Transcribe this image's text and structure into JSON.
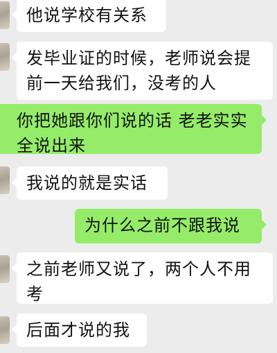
{
  "colors": {
    "background": "#ececec",
    "incoming_bubble": "#ffffff",
    "outgoing_bubble": "#95ec69",
    "text": "#111111"
  },
  "messages": [
    {
      "side": "received",
      "text": "他说学校有关系"
    },
    {
      "side": "received",
      "text": "发毕业证的时候，老师说会提前一天给我们，没考的人"
    },
    {
      "side": "sent",
      "text": "你把她跟你们说的话 老老实实全说出来"
    },
    {
      "side": "received",
      "text": "我说的就是实话"
    },
    {
      "side": "sent",
      "text": "为什么之前不跟我说"
    },
    {
      "side": "received",
      "text": "之前老师又说了，两个人不用考"
    },
    {
      "side": "received",
      "text": "后面才说的我"
    }
  ]
}
